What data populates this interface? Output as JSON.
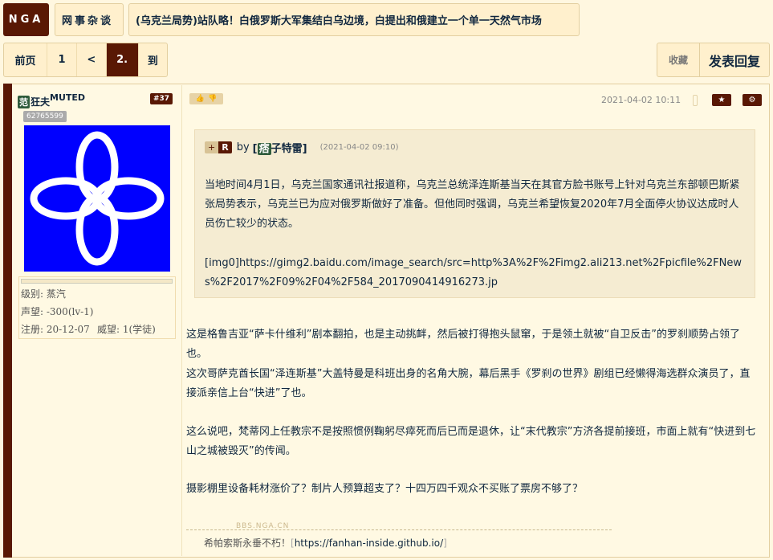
{
  "nav": {
    "logo": "NGA",
    "section": "网事杂谈",
    "thread_title": "(乌克兰局势)站队略！白俄罗斯大军集结白乌边境，白提出和俄建立一个单一天然气市场"
  },
  "pager": {
    "items": [
      {
        "label": "前页"
      },
      {
        "label": "1"
      },
      {
        "label": "<"
      },
      {
        "label": "2."
      },
      {
        "label": "到"
      }
    ]
  },
  "actions": {
    "favorite": "收藏",
    "reply": "发表回复"
  },
  "post": {
    "author_tag": "范",
    "author_name": "狂夫",
    "author_sup": "MUTED",
    "floor": "#37",
    "uid": "62765599",
    "level": "级别: 蒸汽",
    "reputation": "声望: -300(lv-1)",
    "reg": "注册: 20-12-07",
    "prestige": "威望: 1(学徒)",
    "time": "2021-04-02 10:11",
    "star_icon": "★",
    "gear_icon": "⚙",
    "quote": {
      "button_plus": "+",
      "button_r": "R",
      "by": "by",
      "name_tag": "痞",
      "name": "子特雷",
      "time": "(2021-04-02 09:10)",
      "text": "当地时间4月1日，乌克兰国家通讯社报道称，乌克兰总统泽连斯基当天在其官方脸书账号上针对乌克兰东部顿巴斯紧张局势表示，乌克兰已为应对俄罗斯做好了准备。但他同时强调，乌克兰希望恢复2020年7月全面停火协议达成时人员伤亡较少的状态。",
      "img": "[img0]https://gimg2.baidu.com/image_search/src=http%3A%2F%2Fimg2.ali213.net%2Fpicfile%2FNews%2F2017%2F09%2F04%2F584_2017090414916273.jp"
    },
    "paragraphs": [
      "这是格鲁吉亚“萨卡什维利”剧本翻拍，也是主动挑衅，然后被打得抱头鼠窜，于是领土就被“自卫反击”的罗刹顺势占领了也。",
      "这次哥萨克酋长国“泽连斯基”大盖特曼是科班出身的名角大腕，幕后黑手《罗刹の世界》剧组已经懒得海选群众演员了，直接派亲信上台“快进”了也。",
      "这么说吧，梵蒂冈上任教宗不是按照惯例鞠躬尽瘁死而后已而是退休，让“末代教宗”方济各提前接班，市面上就有“快进到七山之城被毁灭”的传闻。",
      "摄影棚里设备耗材涨价了？制片人预算超支了？十四万四千观众不买账了票房不够了？"
    ],
    "watermark": "BBS.NGA.CN",
    "signature_text": "希帕索斯永垂不朽！",
    "signature_link": "https://fanhan-inside.github.io/"
  }
}
